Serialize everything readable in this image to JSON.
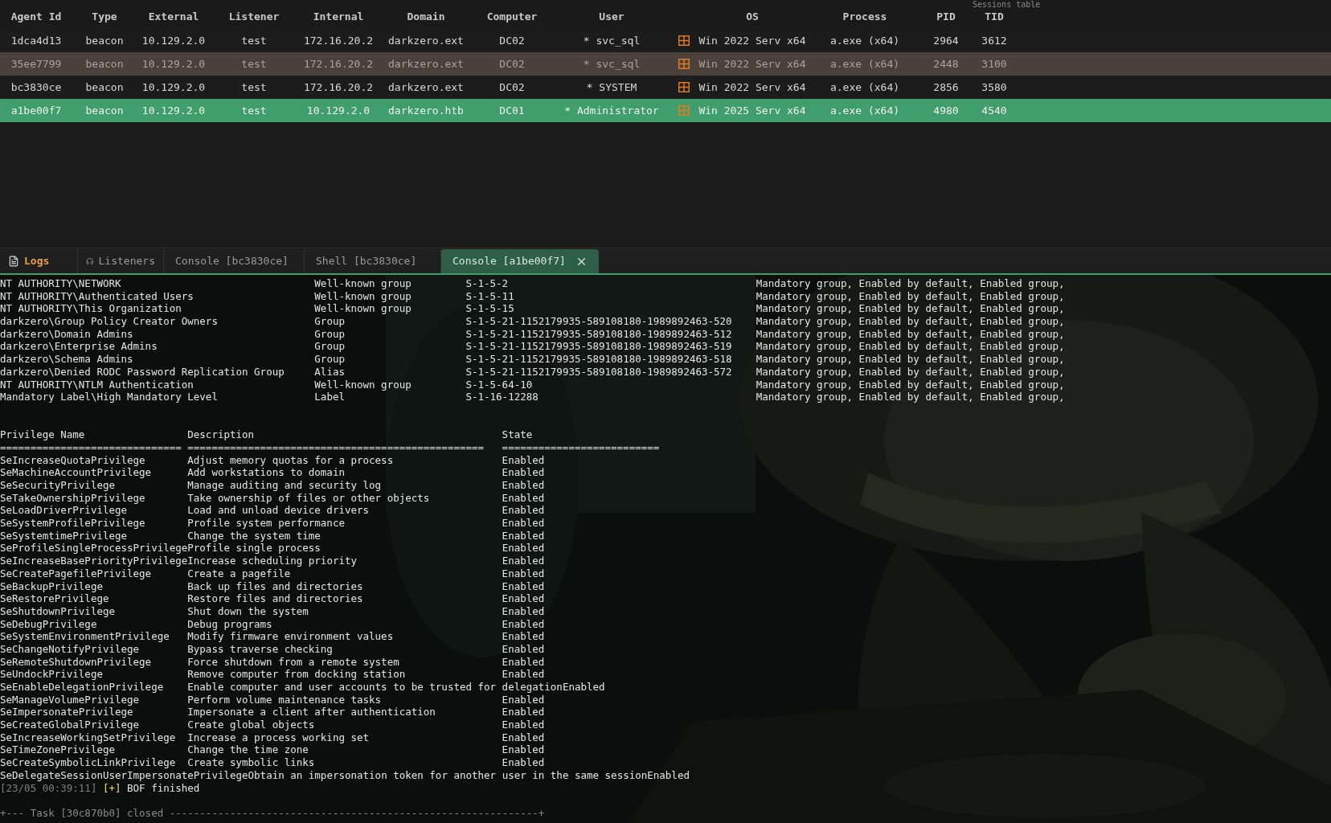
{
  "sessions": {
    "title": "Sessions table",
    "columns": [
      "Agent Id",
      "Type",
      "External",
      "Listener",
      "Internal",
      "Domain",
      "Computer",
      "User",
      "OS",
      "Process",
      "PID",
      "TID"
    ],
    "rows": [
      {
        "cells": [
          "1dca4d13",
          "beacon",
          "10.129.2.0",
          "test",
          "172.16.20.2",
          "darkzero.ext",
          "DC02",
          "* svc_sql",
          "Win 2022 Serv x64",
          "a.exe (x64)",
          "2964",
          "3612"
        ],
        "selected": false,
        "highlighted": false
      },
      {
        "cells": [
          "35ee7799",
          "beacon",
          "10.129.2.0",
          "test",
          "172.16.20.2",
          "darkzero.ext",
          "DC02",
          "* svc_sql",
          "Win 2022 Serv x64",
          "a.exe (x64)",
          "2448",
          "3100"
        ],
        "selected": false,
        "highlighted": true
      },
      {
        "cells": [
          "bc3830ce",
          "beacon",
          "10.129.2.0",
          "test",
          "172.16.20.2",
          "darkzero.ext",
          "DC02",
          "* SYSTEM",
          "Win 2022 Serv x64",
          "a.exe (x64)",
          "2856",
          "3580"
        ],
        "selected": false,
        "highlighted": false
      },
      {
        "cells": [
          "a1be00f7",
          "beacon",
          "10.129.2.0",
          "test",
          "10.129.2.0",
          "darkzero.htb",
          "DC01",
          "* Administrator",
          "Win 2025 Serv x64",
          "a.exe (x64)",
          "4980",
          "4540"
        ],
        "selected": true,
        "highlighted": false
      }
    ]
  },
  "tabs": [
    {
      "label": "Logs",
      "kind": "logs",
      "selected": false
    },
    {
      "label": "Listeners",
      "kind": "listeners",
      "selected": false
    },
    {
      "label": "Console [bc3830ce]",
      "kind": "console",
      "selected": false
    },
    {
      "label": "Shell [bc3830ce]",
      "kind": "console",
      "selected": false
    },
    {
      "label": "Console [a1be00f7]",
      "kind": "console",
      "selected": true
    }
  ],
  "console": {
    "groups": [
      [
        "NT AUTHORITY\\NETWORK",
        "Well-known group",
        "S-1-5-2",
        "Mandatory group, Enabled by default, Enabled group,"
      ],
      [
        "NT AUTHORITY\\Authenticated Users",
        "Well-known group",
        "S-1-5-11",
        "Mandatory group, Enabled by default, Enabled group,"
      ],
      [
        "NT AUTHORITY\\This Organization",
        "Well-known group",
        "S-1-5-15",
        "Mandatory group, Enabled by default, Enabled group,"
      ],
      [
        "darkzero\\Group Policy Creator Owners",
        "Group",
        "S-1-5-21-1152179935-589108180-1989892463-520",
        "Mandatory group, Enabled by default, Enabled group,"
      ],
      [
        "darkzero\\Domain Admins",
        "Group",
        "S-1-5-21-1152179935-589108180-1989892463-512",
        "Mandatory group, Enabled by default, Enabled group,"
      ],
      [
        "darkzero\\Enterprise Admins",
        "Group",
        "S-1-5-21-1152179935-589108180-1989892463-519",
        "Mandatory group, Enabled by default, Enabled group,"
      ],
      [
        "darkzero\\Schema Admins",
        "Group",
        "S-1-5-21-1152179935-589108180-1989892463-518",
        "Mandatory group, Enabled by default, Enabled group,"
      ],
      [
        "darkzero\\Denied RODC Password Replication Group",
        "Alias",
        "S-1-5-21-1152179935-589108180-1989892463-572",
        "Mandatory group, Enabled by default, Enabled group,"
      ],
      [
        "NT AUTHORITY\\NTLM Authentication",
        "Well-known group",
        "S-1-5-64-10",
        "Mandatory group, Enabled by default, Enabled group,"
      ],
      [
        "Mandatory Label\\High Mandatory Level",
        "Label",
        "S-1-16-12288",
        "Mandatory group, Enabled by default, Enabled group,"
      ]
    ],
    "privilege_header": [
      "Privilege Name",
      "Description",
      "State"
    ],
    "privilege_rule": [
      "==============================",
      "=================================================",
      "=========================="
    ],
    "privileges": [
      [
        "SeIncreaseQuotaPrivilege",
        "Adjust memory quotas for a process",
        "Enabled"
      ],
      [
        "SeMachineAccountPrivilege",
        "Add workstations to domain",
        "Enabled"
      ],
      [
        "SeSecurityPrivilege",
        "Manage auditing and security log",
        "Enabled"
      ],
      [
        "SeTakeOwnershipPrivilege",
        "Take ownership of files or other objects",
        "Enabled"
      ],
      [
        "SeLoadDriverPrivilege",
        "Load and unload device drivers",
        "Enabled"
      ],
      [
        "SeSystemProfilePrivilege",
        "Profile system performance",
        "Enabled"
      ],
      [
        "SeSystemtimePrivilege",
        "Change the system time",
        "Enabled"
      ],
      [
        "SeProfileSingleProcessPrivilege",
        "Profile single process",
        "Enabled"
      ],
      [
        "SeIncreaseBasePriorityPrivilege",
        "Increase scheduling priority",
        "Enabled"
      ],
      [
        "SeCreatePagefilePrivilege",
        "Create a pagefile",
        "Enabled"
      ],
      [
        "SeBackupPrivilege",
        "Back up files and directories",
        "Enabled"
      ],
      [
        "SeRestorePrivilege",
        "Restore files and directories",
        "Enabled"
      ],
      [
        "SeShutdownPrivilege",
        "Shut down the system",
        "Enabled"
      ],
      [
        "SeDebugPrivilege",
        "Debug programs",
        "Enabled"
      ],
      [
        "SeSystemEnvironmentPrivilege",
        "Modify firmware environment values",
        "Enabled"
      ],
      [
        "SeChangeNotifyPrivilege",
        "Bypass traverse checking",
        "Enabled"
      ],
      [
        "SeRemoteShutdownPrivilege",
        "Force shutdown from a remote system",
        "Enabled"
      ],
      [
        "SeUndockPrivilege",
        "Remove computer from docking station",
        "Enabled"
      ],
      [
        "SeEnableDelegationPrivilege",
        "Enable computer and user accounts to be trusted for delegation",
        "Enabled"
      ],
      [
        "SeManageVolumePrivilege",
        "Perform volume maintenance tasks",
        "Enabled"
      ],
      [
        "SeImpersonatePrivilege",
        "Impersonate a client after authentication",
        "Enabled"
      ],
      [
        "SeCreateGlobalPrivilege",
        "Create global objects",
        "Enabled"
      ],
      [
        "SeIncreaseWorkingSetPrivilege",
        "Increase a process working set",
        "Enabled"
      ],
      [
        "SeTimeZonePrivilege",
        "Change the time zone",
        "Enabled"
      ],
      [
        "SeCreateSymbolicLinkPrivilege",
        "Create symbolic links",
        "Enabled"
      ],
      [
        "SeDelegateSessionUserImpersonatePrivilege",
        "Obtain an impersonation token for another user in the same session",
        "Enabled"
      ]
    ],
    "log": {
      "time": "[23/05 00:39:11]",
      "marker": "[+]",
      "message": "BOF finished"
    },
    "task_line": "+--- Task [30c870b0] closed -------------------------------------------------------------+"
  }
}
